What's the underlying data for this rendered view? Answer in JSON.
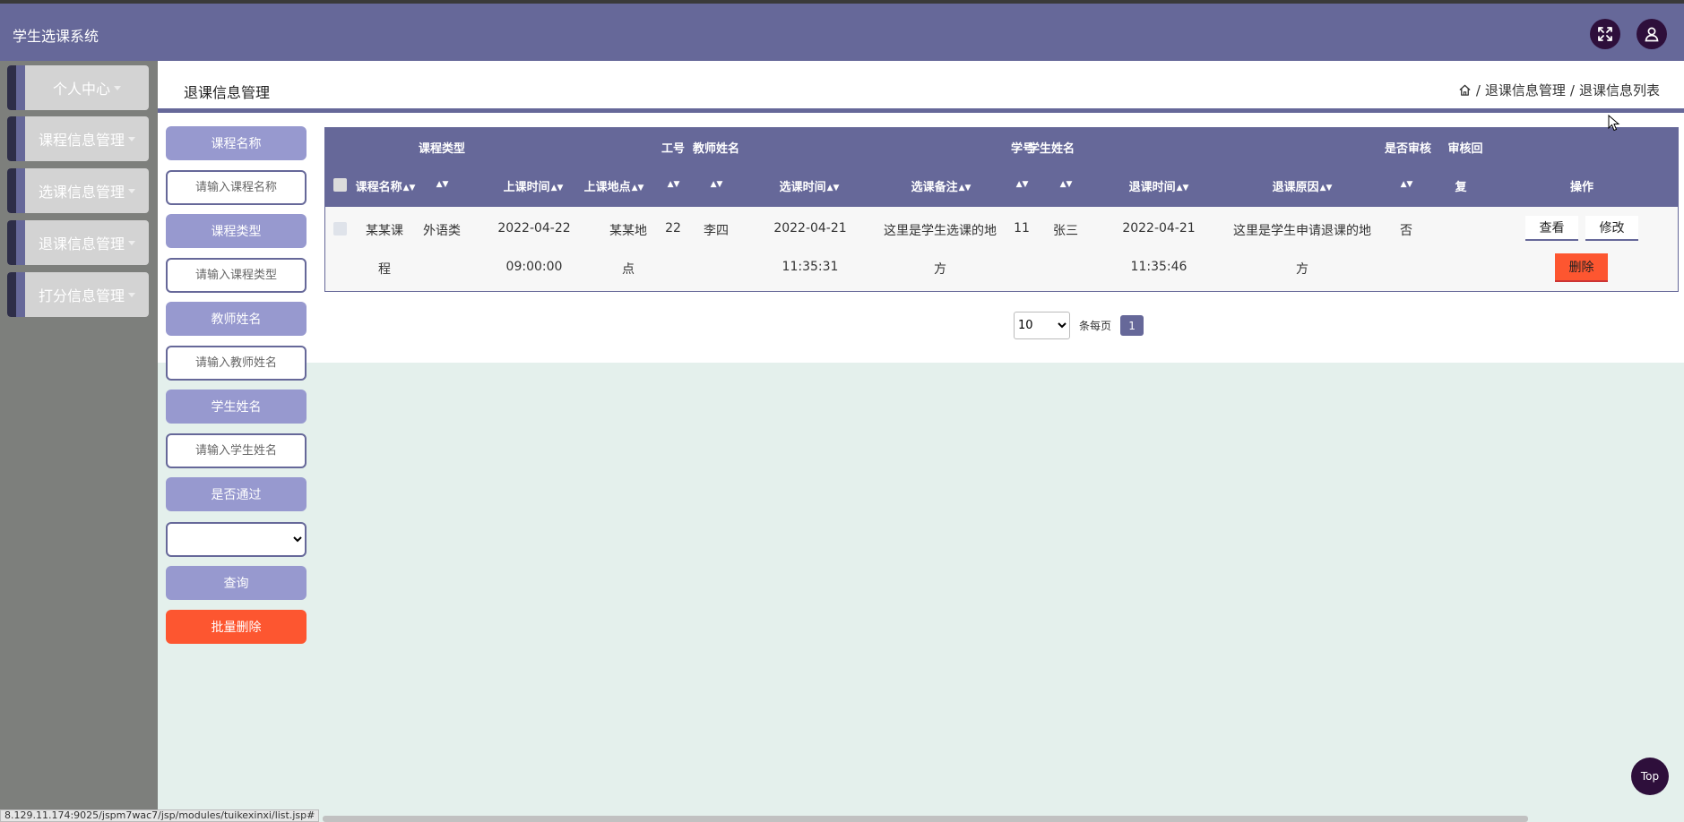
{
  "app": {
    "title": "学生选课系统"
  },
  "header": {
    "fullscreen_icon": "expand-icon",
    "user_icon": "user-icon"
  },
  "sidebar": {
    "items": [
      {
        "label": "个人中心"
      },
      {
        "label": "课程信息管理"
      },
      {
        "label": "选课信息管理"
      },
      {
        "label": "退课信息管理"
      },
      {
        "label": "打分信息管理"
      }
    ]
  },
  "page": {
    "title": "退课信息管理",
    "breadcrumb": {
      "sep": "/",
      "level1": "退课信息管理",
      "level2": "退课信息列表"
    }
  },
  "filters": {
    "course_name": {
      "label": "课程名称",
      "placeholder": "请输入课程名称"
    },
    "course_type": {
      "label": "课程类型",
      "placeholder": "请输入课程类型"
    },
    "teacher_name": {
      "label": "教师姓名",
      "placeholder": "请输入教师姓名"
    },
    "student_name": {
      "label": "学生姓名",
      "placeholder": "请输入学生姓名"
    },
    "passed": {
      "label": "是否通过"
    },
    "query_button": "查询",
    "batch_delete_button": "批量删除"
  },
  "table": {
    "headers_top": {
      "course_type": "课程类型",
      "teacher_no": "工号",
      "teacher_name": "教师姓名",
      "student_no": "学号",
      "student_name": "学生姓名",
      "is_reviewed": "是否审核",
      "review_reply": "审核回"
    },
    "headers": {
      "course_name": "课程名称",
      "class_time": "上课时间",
      "class_place": "上课地点",
      "select_time": "选课时间",
      "select_note": "选课备注",
      "withdraw_time": "退课时间",
      "withdraw_reason": "退课原因",
      "reply_tail": "复",
      "actions": "操作"
    },
    "sort_glyph": "▲▼",
    "rows": [
      {
        "course_name_1": "某某课",
        "course_name_2": "程",
        "course_type": "外语类",
        "class_time_1": "2022-04-22",
        "class_time_2": "09:00:00",
        "class_place_1": "某某地",
        "class_place_2": "点",
        "teacher_no": "22",
        "teacher_name": "李四",
        "select_time_1": "2022-04-21",
        "select_time_2": "11:35:31",
        "select_note_1": "这里是学生选课的地",
        "select_note_2": "方",
        "student_no": "11",
        "student_name": "张三",
        "withdraw_time_1": "2022-04-21",
        "withdraw_time_2": "11:35:46",
        "withdraw_reason_1": "这里是学生申请退课的地",
        "withdraw_reason_2": "方",
        "is_reviewed": "否",
        "view": "查看",
        "edit": "修改",
        "delete": "删除"
      }
    ]
  },
  "pagination": {
    "page_size": "10",
    "per_page_label": "条每页",
    "current_page": "1"
  },
  "top_button": "Top",
  "status_url": "8.129.11.174:9025/jspm7wac7/jsp/modules/tuikexinxi/list.jsp#",
  "colors": {
    "primary": "#666899",
    "accent_light": "#9799cf",
    "danger": "#fd5630",
    "dark_icon": "#2e0f3b",
    "sidebar": "#7d7f7c",
    "background": "#e4f0ec"
  }
}
